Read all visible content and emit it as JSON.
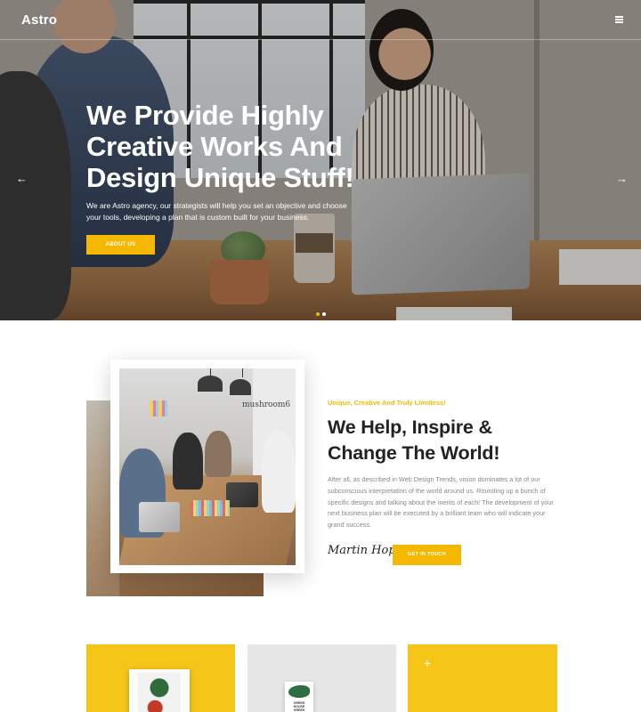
{
  "header": {
    "logo": "Astro",
    "menu_icon": "hamburger-icon"
  },
  "hero": {
    "title": "We Provide Highly Creative Works And Design Unique Stuff!",
    "text": "We are Astro agency, our strategists will help you set an objective and choose your tools, developing a plan that is custom built for your business.",
    "button_label": "ABOUT US",
    "arrow_left": "←",
    "arrow_right": "→",
    "slides_count": 2,
    "active_slide": 1,
    "accent_color": "#f5b800"
  },
  "about": {
    "photo_sign": "mushroom6",
    "kicker": "Unique, Creative And Truly Limitless!",
    "title": "We Help, Inspire & Change The World!",
    "body": "After all, as described in Web Design Trends, vision dominates a lot of our subconscious interpretation of the world around us. Rounding up a bunch of specific designs and talking about the merits of each! The development of your next business plan will be executed by a brilliant team who will indicate your grand success.",
    "signature": "Martin Hope",
    "button_label": "GET IN TOUCH"
  },
  "portfolio": {
    "card_2_label": "GREEN HOUSE GREEN",
    "card_3_icon": "plus-icon",
    "card_3_plus": "+",
    "card_colors": [
      "#f5c518",
      "#e6e6e6",
      "#f5c518"
    ]
  }
}
